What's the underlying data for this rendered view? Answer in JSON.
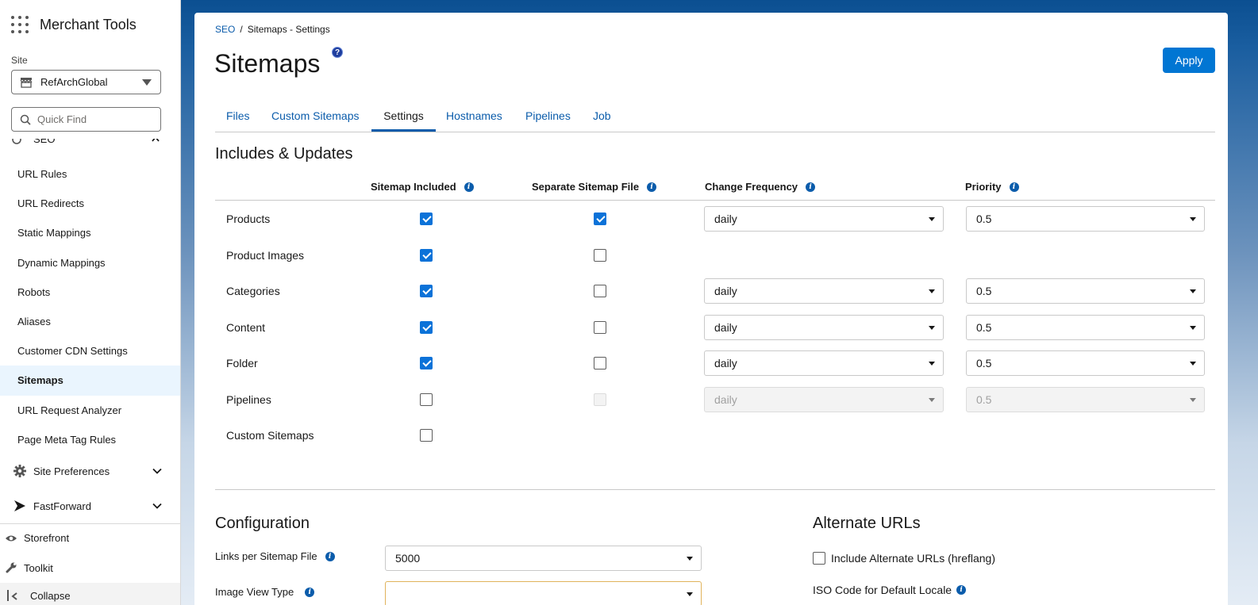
{
  "sidebar": {
    "app_title": "Merchant Tools",
    "site_label": "Site",
    "site_value": "RefArchGlobal",
    "quick_find_placeholder": "Quick Find",
    "partial_group": "SEO",
    "items": [
      {
        "label": "URL Rules",
        "active": false
      },
      {
        "label": "URL Redirects",
        "active": false
      },
      {
        "label": "Static Mappings",
        "active": false
      },
      {
        "label": "Dynamic Mappings",
        "active": false
      },
      {
        "label": "Robots",
        "active": false
      },
      {
        "label": "Aliases",
        "active": false
      },
      {
        "label": "Customer CDN Settings",
        "active": false
      },
      {
        "label": "Sitemaps",
        "active": true
      },
      {
        "label": "URL Request Analyzer",
        "active": false
      },
      {
        "label": "Page Meta Tag Rules",
        "active": false
      }
    ],
    "groups": {
      "site_preferences": "Site Preferences",
      "fastforward": "FastForward"
    },
    "bottom": {
      "storefront": "Storefront",
      "toolkit": "Toolkit",
      "collapse": "Collapse"
    }
  },
  "breadcrumb": {
    "parent": "SEO",
    "separator": "/",
    "current": "Sitemaps - Settings"
  },
  "page": {
    "title": "Sitemaps",
    "help_glyph": "?",
    "apply_label": "Apply"
  },
  "tabs": [
    {
      "label": "Files",
      "active": false
    },
    {
      "label": "Custom Sitemaps",
      "active": false
    },
    {
      "label": "Settings",
      "active": true
    },
    {
      "label": "Hostnames",
      "active": false
    },
    {
      "label": "Pipelines",
      "active": false
    },
    {
      "label": "Job",
      "active": false
    }
  ],
  "includes": {
    "title": "Includes & Updates",
    "columns": {
      "included": "Sitemap Included",
      "separate": "Separate Sitemap File",
      "frequency": "Change Frequency",
      "priority": "Priority"
    },
    "info_glyph": "i",
    "rows": [
      {
        "label": "Products",
        "included": true,
        "separate": true,
        "frequency": "daily",
        "priority": "0.5"
      },
      {
        "label": "Product Images",
        "included": true,
        "separate": false
      },
      {
        "label": "Categories",
        "included": true,
        "separate": false,
        "frequency": "daily",
        "priority": "0.5"
      },
      {
        "label": "Content",
        "included": true,
        "separate": false,
        "frequency": "daily",
        "priority": "0.5"
      },
      {
        "label": "Folder",
        "included": true,
        "separate": false,
        "frequency": "daily",
        "priority": "0.5"
      },
      {
        "label": "Pipelines",
        "included": false,
        "separate": false,
        "separate_disabled": true,
        "frequency": "daily",
        "priority": "0.5",
        "selects_disabled": true
      },
      {
        "label": "Custom Sitemaps",
        "included": false
      }
    ]
  },
  "configuration": {
    "title": "Configuration",
    "links_label": "Links per Sitemap File",
    "links_value": "5000",
    "image_view_label": "Image View Type",
    "image_view_value": ""
  },
  "alternate": {
    "title": "Alternate URLs",
    "include_label": "Include Alternate URLs (hreflang)",
    "include_checked": false,
    "iso_label": "ISO Code for Default Locale"
  },
  "colors": {
    "accent": "#0176d3",
    "link": "#0b5cab",
    "header_bg": "#0b4f91",
    "active_nav_bg": "#eaf5fe"
  }
}
